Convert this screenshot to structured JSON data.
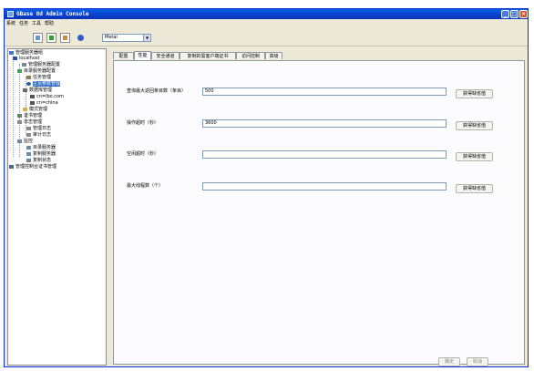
{
  "window": {
    "title": "GBase 8d  Admin  Console"
  },
  "menu": [
    "系统",
    "任务",
    "工具",
    "帮助"
  ],
  "toolbar": {
    "theme_value": "Metal"
  },
  "tree": {
    "nodes": [
      "管理服务器组",
      "localhost",
      "管理服务器配置",
      "目录服务器配置",
      "任务管理",
      "主及参数管理",
      "数据库管理",
      "cn=lbo.com",
      "cn=china",
      "模式管理",
      "证书管理",
      "日志管理",
      "管理日志",
      "审计日志",
      "监控",
      "目录服务器",
      "复制服务器",
      "复制状态",
      "管理控制台证书管理"
    ]
  },
  "tabs": [
    "配置",
    "性能",
    "安全通道",
    "复制的需客户端证书",
    "访问控制",
    "高级"
  ],
  "active_tab": 1,
  "form": {
    "fields": [
      {
        "label": "查询最大返回条目数（条目）",
        "value": "500"
      },
      {
        "label": "操作超时（秒）",
        "value": "3600"
      },
      {
        "label": "空闲超时（秒）",
        "value": ""
      },
      {
        "label": "最大线程数（个）",
        "value": ""
      }
    ],
    "default_button": "获得缺省值"
  },
  "footer": {
    "ok": "确定",
    "cancel": "取消"
  }
}
